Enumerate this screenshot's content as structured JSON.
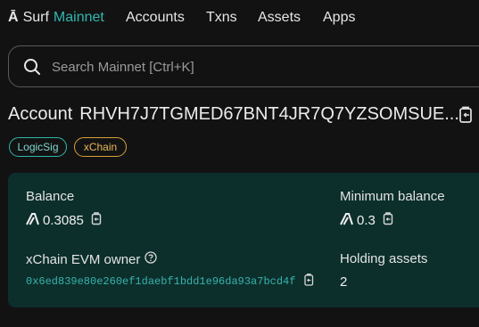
{
  "nav": {
    "logo": "Ā",
    "brand": "Surf",
    "network": "Mainnet",
    "links": [
      "Accounts",
      "Txns",
      "Assets",
      "Apps"
    ]
  },
  "search": {
    "placeholder": "Search Mainnet [Ctrl+K]"
  },
  "account": {
    "label": "Account",
    "address_truncated": "RHVH7J7TGMED67BNT4JR7Q7YZSOMSUE...",
    "badges": [
      "LogicSig",
      "xChain"
    ]
  },
  "fields": {
    "balance": {
      "label": "Balance",
      "value": "0.3085"
    },
    "min_balance": {
      "label": "Minimum balance",
      "value": "0.3"
    },
    "evm_owner": {
      "label": "xChain EVM owner",
      "value": "0x6ed839e80e260ef1daebf1bdd1e96da93a7bcd4f"
    },
    "holding_assets": {
      "label": "Holding assets",
      "value": "2"
    }
  },
  "colors": {
    "background": "#121212",
    "accent": "#2fb7b0",
    "card": "#0c2f2c",
    "xchain_badge": "#d7a23a"
  }
}
